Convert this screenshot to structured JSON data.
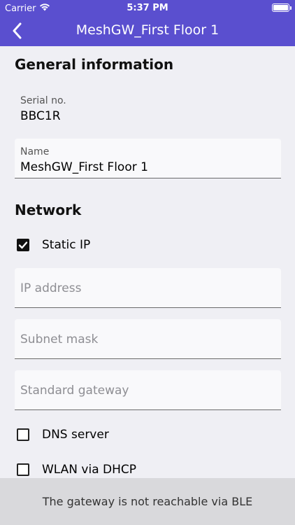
{
  "status_bar": {
    "carrier": "Carrier",
    "time": "5:37 PM"
  },
  "navbar": {
    "title": "MeshGW_First Floor 1"
  },
  "general": {
    "heading": "General information",
    "serial_label": "Serial no.",
    "serial_value": "BBC1R",
    "name_label": "Name",
    "name_value": "MeshGW_First Floor 1"
  },
  "network": {
    "heading": "Network",
    "static_ip": {
      "label": "Static IP",
      "checked": true
    },
    "ip_address": {
      "placeholder": "IP address"
    },
    "subnet_mask": {
      "placeholder": "Subnet mask"
    },
    "standard_gateway": {
      "placeholder": "Standard gateway"
    },
    "dns_server": {
      "label": "DNS server",
      "checked": false
    },
    "wlan_dhcp": {
      "label": "WLAN via DHCP",
      "checked": false
    }
  },
  "footer": {
    "message": "The gateway is not reachable via BLE"
  },
  "colors": {
    "header": "#5a4fcf",
    "background": "#efeff4",
    "footer": "#d9d9dc"
  }
}
